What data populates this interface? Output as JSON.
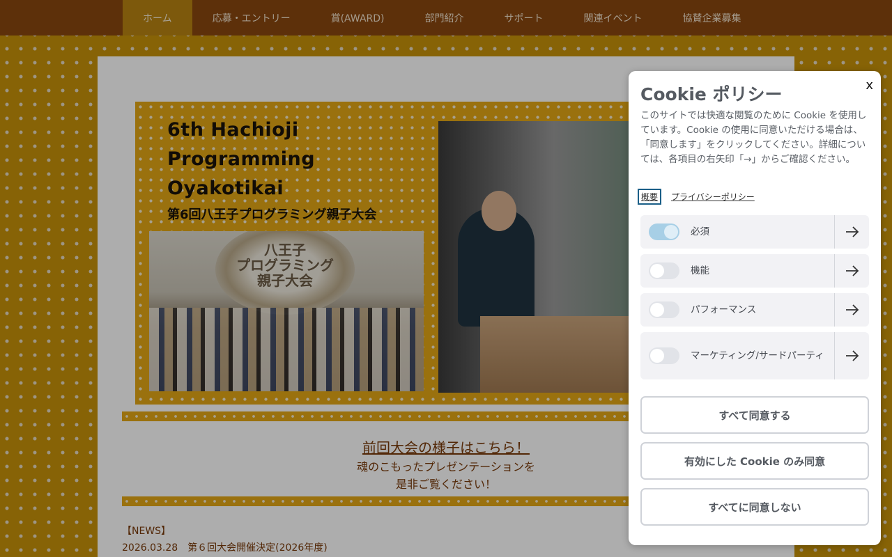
{
  "nav": {
    "items": [
      {
        "label": "ホーム"
      },
      {
        "label": "応募・エントリー"
      },
      {
        "label": "賞(AWARD)"
      },
      {
        "label": "部門紹介"
      },
      {
        "label": "サポート"
      },
      {
        "label": "関連イベント"
      },
      {
        "label": "協賛企業募集"
      }
    ],
    "active_index": 0
  },
  "banner": {
    "title_en_line1": "6th Hachioji",
    "title_en_line2": "Programming",
    "title_en_line3": "Oyakotikai",
    "title_jp": "第6回八王子プログラミング親子大会",
    "crest_line1": "八王子",
    "crest_line2": "プログラミング",
    "crest_line3": "親子大会"
  },
  "main": {
    "prev_link": "前回大会の様子はこちら！",
    "prev_desc_line1": "魂のこもったプレゼンテーションを",
    "prev_desc_line2": "是非ご覧ください！",
    "news_heading": "【NEWS】",
    "news_item": "2026.03.28　第６回大会開催決定(2026年度)"
  },
  "cookie": {
    "title": "Cookie ポリシー",
    "close": "x",
    "description": "このサイトでは快適な閲覧のために Cookie を使用しています。Cookie の使用に同意いただける場合は、「同意します」をクリックしてください。詳細については、各項目の右矢印「→」からご確認ください。",
    "tabs": [
      {
        "label": "概要"
      },
      {
        "label": "プライバシーポリシー"
      }
    ],
    "categories": [
      {
        "label": "必須",
        "enabled": true
      },
      {
        "label": "機能",
        "enabled": false
      },
      {
        "label": "パフォーマンス",
        "enabled": false
      },
      {
        "label": "マーケティング/サードパーティ",
        "enabled": false
      }
    ],
    "buttons": {
      "accept_all": "すべて同意する",
      "accept_selected": "有効にした Cookie のみ同意",
      "reject_all": "すべてに同意しない"
    }
  },
  "colors": {
    "nav_bg": "#8a4710",
    "nav_active": "#b98412",
    "page_bg": "#c8920a",
    "banner_bg": "#e3a716",
    "link_text": "#7a3a0a",
    "toggle_on": "#a7cfe6"
  }
}
